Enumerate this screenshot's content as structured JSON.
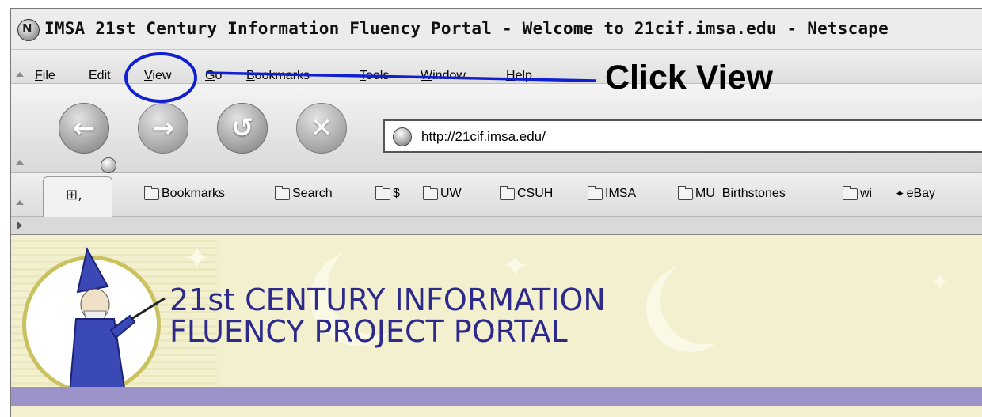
{
  "window": {
    "title": "IMSA 21st Century Information Fluency Portal - Welcome to 21cif.imsa.edu - Netscape"
  },
  "menubar": {
    "items": [
      {
        "u": "F",
        "rest": "ile"
      },
      {
        "u": "",
        "rest": "Edit"
      },
      {
        "u": "V",
        "rest": "iew"
      },
      {
        "u": "G",
        "rest": "o"
      },
      {
        "u": "B",
        "rest": "ookmarks"
      },
      {
        "u": "T",
        "rest": "ools"
      },
      {
        "u": "W",
        "rest": "indow"
      },
      {
        "u": "H",
        "rest": "elp"
      }
    ]
  },
  "navigation": {
    "url": "http://21cif.imsa.edu/"
  },
  "bookmarks": [
    "Bookmarks",
    "Search",
    "$",
    "UW",
    "CSUH",
    "IMSA",
    "MU_Birthstones",
    "wi",
    "eBay"
  ],
  "content": {
    "heading_line1": "21st CENTURY INFORMATION",
    "heading_line2": "FLUENCY PROJECT PORTAL"
  },
  "annotation": {
    "text": "Click View",
    "color": "#1020d0"
  },
  "colors": {
    "heading": "#2e2a8c",
    "banner_bg": "#f3f0cf",
    "band": "#9c93c9"
  }
}
